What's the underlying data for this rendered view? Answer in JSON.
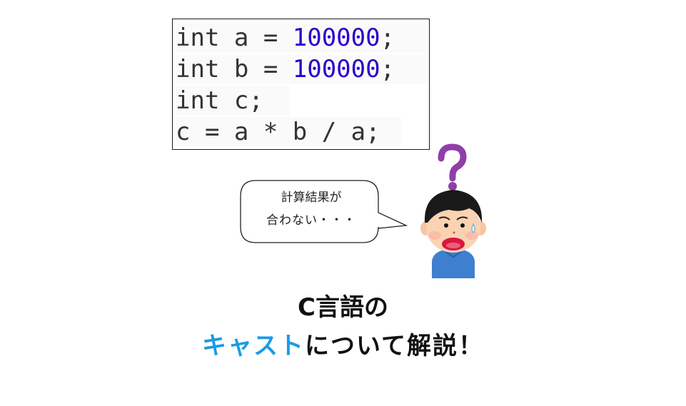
{
  "code": {
    "lines": [
      {
        "pre": "int a = ",
        "num": "100000",
        "post": ";"
      },
      {
        "pre": "int b = ",
        "num": "100000",
        "post": ";"
      },
      {
        "pre": "int c;",
        "num": "",
        "post": ""
      },
      {
        "pre": "c = a * b / a;",
        "num": "",
        "post": ""
      }
    ]
  },
  "speech_bubble": {
    "line1": "計算結果が",
    "line2": "合わない・・・"
  },
  "character": {
    "icon": "confused-boy-icon",
    "question_mark": "?"
  },
  "title": {
    "line1": "C言語の",
    "line2_accent": "キャスト",
    "line2_rest": "について解説！"
  },
  "colors": {
    "number_literal": "#2a00cc",
    "code_text": "#333333",
    "accent": "#1a9be6",
    "question_mark": "#8e3fa8",
    "shirt": "#3e7fd0",
    "mouth": "#d7183f"
  }
}
